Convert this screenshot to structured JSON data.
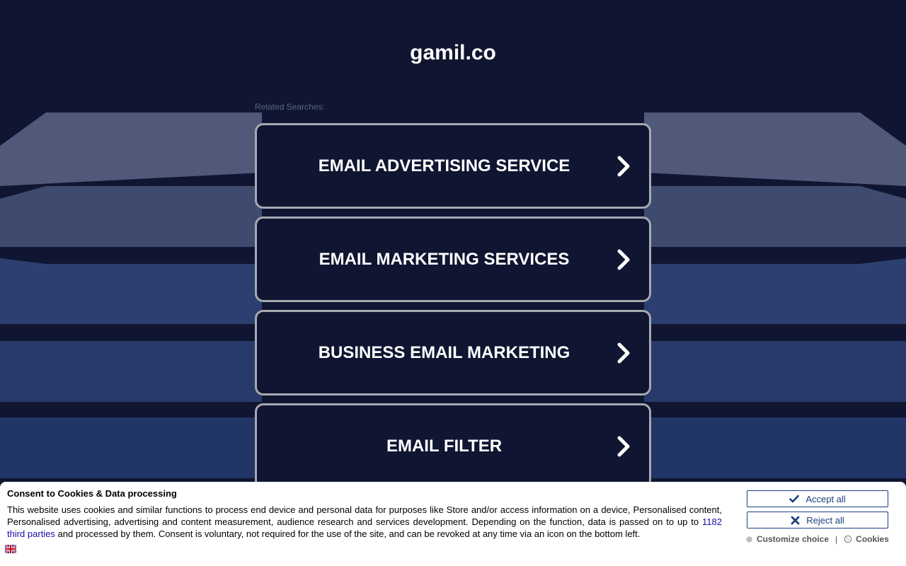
{
  "site": {
    "title": "gamil.co"
  },
  "related": {
    "label": "Related Searches:",
    "items": [
      {
        "label": "EMAIL ADVERTISING SERVICE"
      },
      {
        "label": "EMAIL MARKETING SERVICES"
      },
      {
        "label": "BUSINESS EMAIL MARKETING"
      },
      {
        "label": "EMAIL FILTER"
      }
    ]
  },
  "consent": {
    "title": "Consent to Cookies & Data processing",
    "text_before": "This website uses cookies and similar functions to process end device and personal data for purposes like Store and/or access information on a device, Personalised content, Personalised advertising, advertising and content measurement, audience research and services development. Depending on the function, data is passed on to up to ",
    "third_parties_link": "1182 third parties",
    "text_after": " and processed by them. Consent is voluntary, not required for the use of the site, and can be revoked at any time via an icon on the bottom left.",
    "accept_label": "Accept all",
    "reject_label": "Reject all",
    "customize_label": "Customize choice",
    "separator": "|",
    "cookies_label": "Cookies"
  },
  "colors": {
    "background": "#101631",
    "button_border": "#a7a9b1",
    "consent_accent": "#1c3f7e"
  },
  "icons": {
    "search_chevron": "chevron-right-icon",
    "accept": "check-icon",
    "reject": "x-icon",
    "customize": "gear-icon",
    "cookies": "cookie-icon",
    "language": "uk-flag-icon"
  }
}
